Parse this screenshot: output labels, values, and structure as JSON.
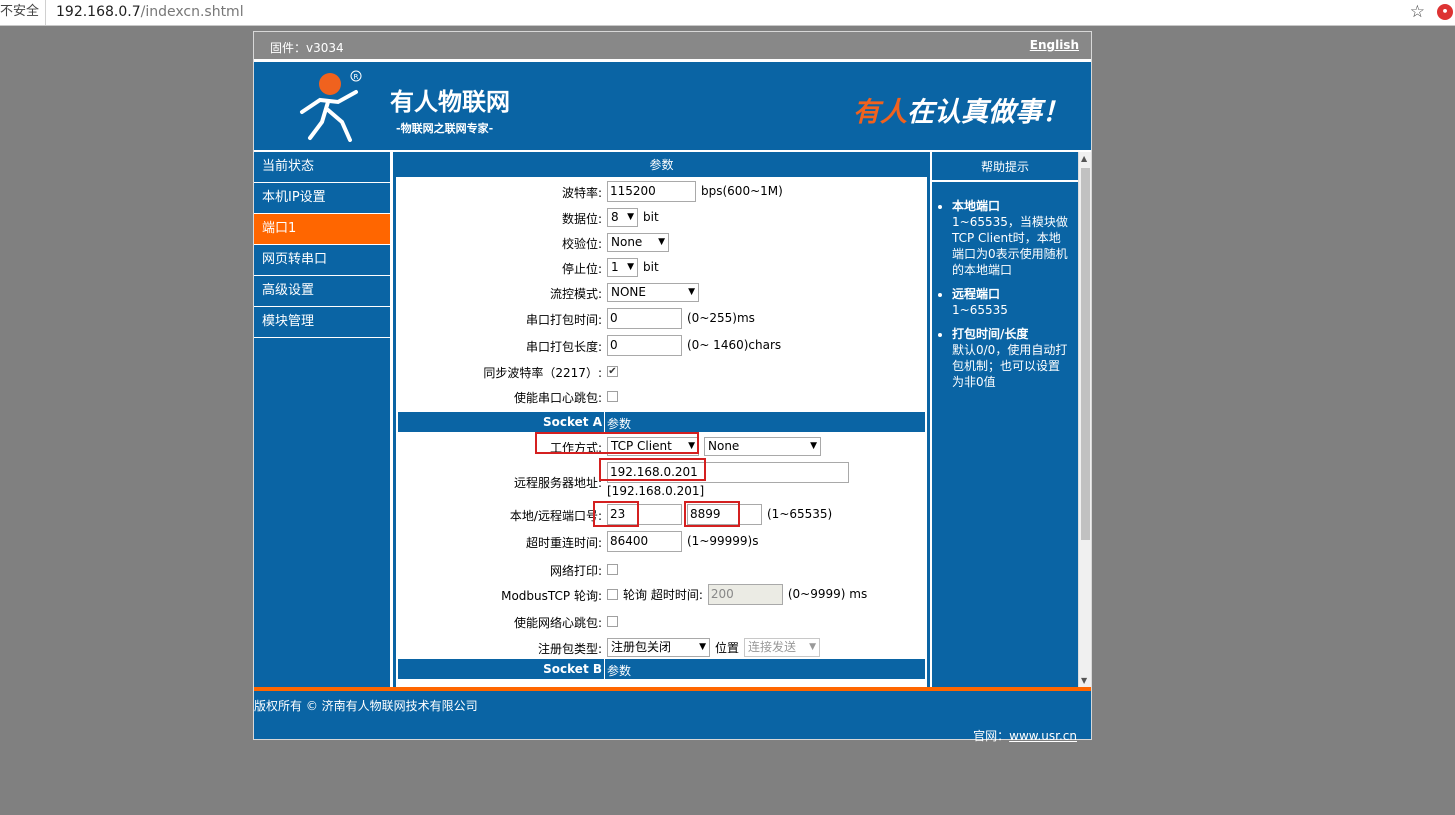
{
  "browser": {
    "security": "不安全",
    "url_host": "192.168.0.7",
    "url_path": "/indexcn.shtml"
  },
  "topbar": {
    "firmware": "固件：v3034",
    "language_link": "English"
  },
  "header": {
    "brand": "有人物联网",
    "subtitle": "-物联网之联网专家-",
    "slogan_highlight": "有人",
    "slogan_rest": "在认真做事！"
  },
  "nav": {
    "items": [
      {
        "label": "当前状态"
      },
      {
        "label": "本机IP设置"
      },
      {
        "label": "端口1"
      },
      {
        "label": "网页转串口"
      },
      {
        "label": "高级设置"
      },
      {
        "label": "模块管理"
      }
    ]
  },
  "main": {
    "heading": "参数",
    "baud_label": "波特率:",
    "baud_value": "115200",
    "baud_unit": "bps(600~1M)",
    "databits_label": "数据位:",
    "databits_value": "8",
    "databits_unit": "bit",
    "parity_label": "校验位:",
    "parity_value": "None",
    "stopbits_label": "停止位:",
    "stopbits_value": "1",
    "stopbits_unit": "bit",
    "flow_label": "流控模式:",
    "flow_value": "NONE",
    "packtime_label": "串口打包时间:",
    "packtime_value": "0",
    "packtime_unit": "(0~255)ms",
    "packlen_label": "串口打包长度:",
    "packlen_value": "0",
    "packlen_unit": "(0~ 1460)chars",
    "syncbaud_label": "同步波特率（2217）:",
    "syncbaud_check": "✔",
    "serialhb_label": "使能串口心跳包:",
    "socket_a_title": "Socket A",
    "socket_a_param": "参数",
    "mode_label": "工作方式:",
    "mode_value": "TCP Client",
    "mode_extra_value": "None",
    "remote_label": "远程服务器地址:",
    "remote_value": "192.168.0.201",
    "remote_hint": "[192.168.0.201]",
    "ports_label": "本地/远程端口号:",
    "local_port": "23",
    "remote_port": "8899",
    "ports_unit": "(1~65535)",
    "reconnect_label": "超时重连时间:",
    "reconnect_value": "86400",
    "reconnect_unit": "(1~99999)s",
    "netprint_label": "网络打印:",
    "modbus_label": "ModbusTCP 轮询:",
    "modbus_poll_text": "轮询 超时时间:",
    "modbus_timeout": "200",
    "modbus_unit": "(0~9999) ms",
    "nethb_label": "使能网络心跳包:",
    "reg_label": "注册包类型:",
    "reg_value": "注册包关闭",
    "reg_pos_label": "位置",
    "reg_pos_value": "连接发送",
    "socket_b_title": "Socket B",
    "socket_b_param": "参数"
  },
  "help": {
    "heading": "帮助提示",
    "items": [
      {
        "title": "本地端口",
        "text": "1~65535，当模块做TCP Client时，本地端口为0表示使用随机的本地端口"
      },
      {
        "title": "远程端口",
        "text": "1~65535"
      },
      {
        "title": "打包时间/长度",
        "text": "默认0/0，使用自动打包机制；也可以设置为非0值"
      }
    ]
  },
  "footer": {
    "copyright": "版权所有 © 济南有人物联网技术有限公司",
    "site_label": "官网：",
    "site_link": "www.usr.cn"
  },
  "colors": {
    "primary": "#0a64a4",
    "accent": "#ff6600",
    "highlight_box": "#d42020"
  }
}
